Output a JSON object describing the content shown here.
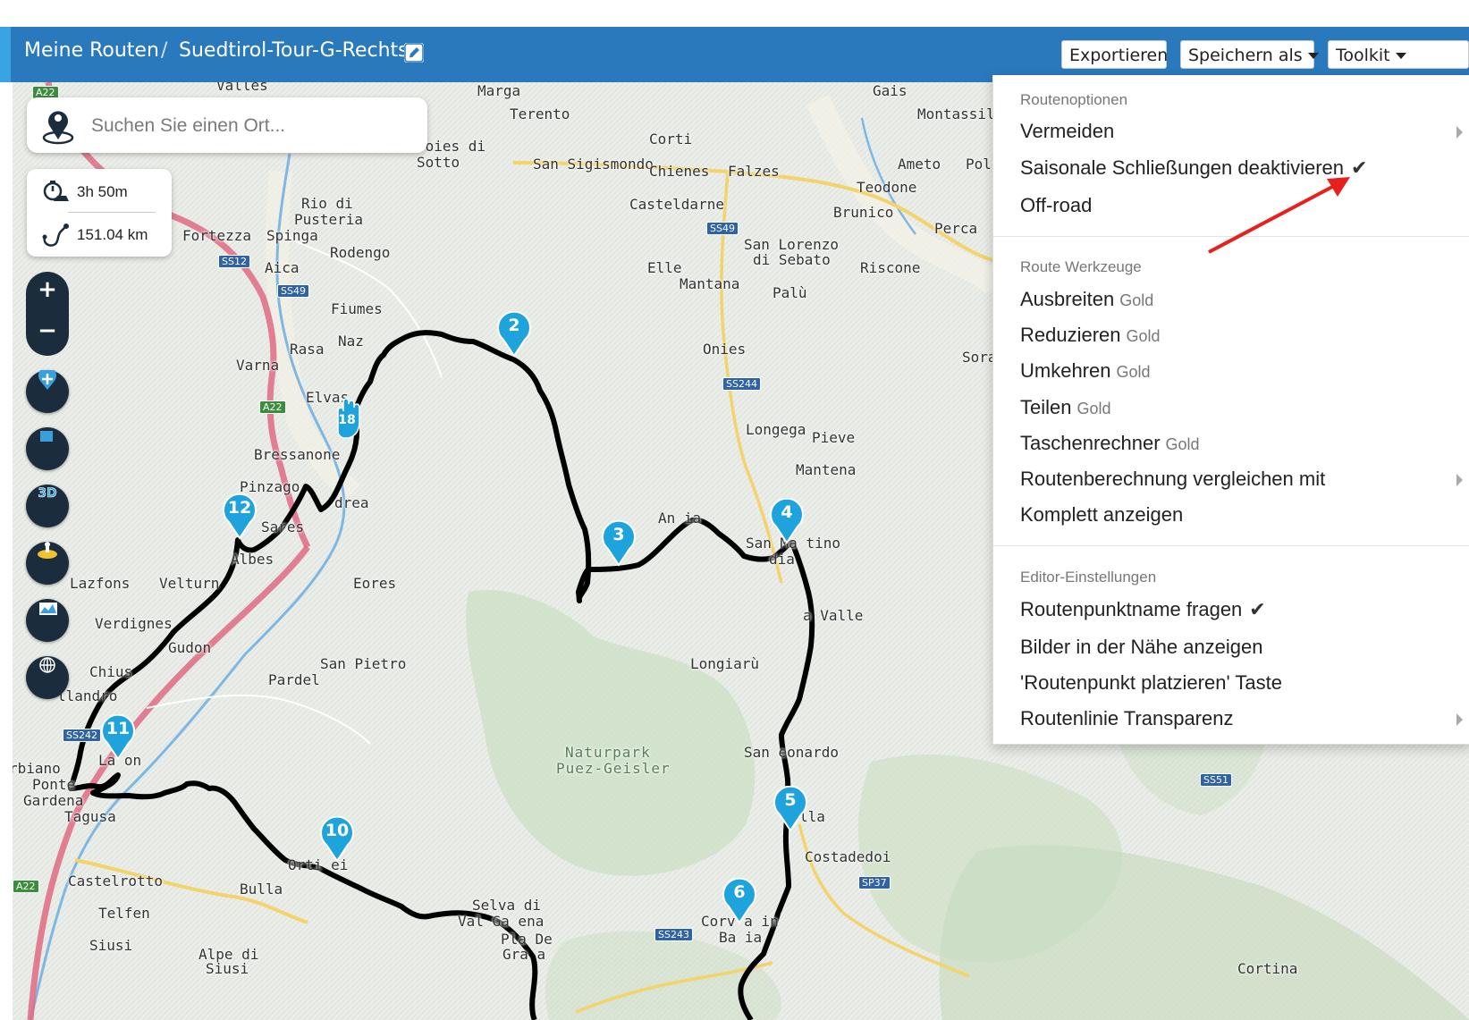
{
  "header": {
    "breadcrumb_home": "Meine Routen",
    "breadcrumb_sep": "/",
    "route_name": "Suedtirol-Tour-G-Rechts",
    "export_label": "Exportieren",
    "save_as_label": "Speichern als",
    "toolkit_label": "Toolkit",
    "bar_color": "#2a79bd"
  },
  "search": {
    "placeholder": "Suchen Sie einen Ort..."
  },
  "stats": {
    "duration": "3h 50m",
    "distance": "151.04 km"
  },
  "controls": {
    "zoom_in": "+",
    "zoom_out": "−",
    "three_d": "3D"
  },
  "menu": {
    "section_route_options": "Routenoptionen",
    "item_avoid": "Vermeiden",
    "item_seasonal": "Saisonale Schließungen deaktivieren",
    "item_offroad": "Off-road",
    "section_route_tools": "Route Werkzeuge",
    "item_expand": "Ausbreiten",
    "item_reduce": "Reduzieren",
    "item_reverse": "Umkehren",
    "item_split": "Teilen",
    "item_calculator": "Taschenrechner",
    "gold": "Gold",
    "item_compare": "Routenberechnung vergleichen mit",
    "item_show_all": "Komplett anzeigen",
    "section_editor": "Editor-Einstellungen",
    "item_ask_name": "Routenpunktname fragen",
    "item_nearby_images": "Bilder in der Nähe anzeigen",
    "item_place_button": "'Routenpunkt platzieren' Taste",
    "item_transparency": "Routenlinie Transparenz",
    "checkmark": "✔"
  },
  "waypoints": [
    "2",
    "3",
    "4",
    "5",
    "6",
    "10",
    "11",
    "12",
    "18"
  ],
  "map_labels": {
    "valles": "Valles",
    "marga": "Marga",
    "terento": "Terento",
    "gais": "Gais",
    "montassilone": "Montassilo",
    "joies": "Joies di",
    "sotto": "Sotto",
    "san_sigismondo": "San Sigismondo",
    "corti": "Corti",
    "chienes": "Chienes",
    "falzes": "Falzes",
    "ameto": "Ameto",
    "poli": "Poli",
    "teodone": "Teodone",
    "brunico": "Brunico",
    "perca": "Perca",
    "castel_darne": "Casteldarne",
    "rio_di": "Rio di",
    "pusteria": "Pusteria",
    "fortezza": "Fortezza",
    "spinga": "Spinga",
    "rodengo": "Rodengo",
    "aica": "Aica",
    "san_lorenzo": "San Lorenzo",
    "di_sebato": "di Sebato",
    "riscone": "Riscone",
    "elle": "Elle",
    "mantana": "Mantana",
    "palu": "Palù",
    "fiumes": "Fiumes",
    "naz": "Naz",
    "rasa": "Rasa",
    "varna": "Varna",
    "onies": "Onies",
    "sora": "Sora",
    "elvas": "Elvas",
    "bressanone": "Bressanone",
    "longega": "Longega",
    "pieve": "Pieve",
    "mantena": "Mantena",
    "pinzago": "Pinzago",
    "andrea": "drea",
    "sares": "Sares",
    "albes": "Albes",
    "lazfons": "Lazfons",
    "velturno": "Velturn",
    "eores": "Eores",
    "antermoia": "An       ia",
    "san_martino": "San Ma  tino",
    "badia": "   dia",
    "la_valle": "a Valle",
    "verdignes": "Verdignes",
    "gudon": "Gudon",
    "chiusa": "Chius",
    "san_pietro": "San Pietro",
    "pardel": "Pardel",
    "longiaru": "Longiarù",
    "villandro": "llandro",
    "san_leonardo": "San  eonardo",
    "naturpark": "Naturpark",
    "puez_geisler": "Puez-Geisler",
    "barbiano": "rbiano",
    "ponte": "Ponte",
    "gardena": "Gardena",
    "tagusa": "Tagusa",
    "laion": "La  on",
    "costadedoi": "Costadedoi",
    "castelrotto": "Castelrotto",
    "bulla": "Bulla",
    "telfen": "Telfen",
    "siusi": "Siusi",
    "alpe_di": "Alpe di",
    "siusi2": "Siusi",
    "ortisei": "Orti ei",
    "selva": "Selva di",
    "val_gardena": "Val Ga  ena",
    "plan_de": "Pla  De",
    "gralba": "Gra  a",
    "corvara": "Corv  a in",
    "badia2": "Ba  ia",
    "cortina": "Cortina",
    "la_villa": "  lla"
  },
  "road_signs": {
    "a22_top": "A22",
    "ss12": "SS12",
    "ss49": "SS49",
    "ss49b": "SS49",
    "a22_mid": "A22",
    "ss244": "SS244",
    "ss242": "SS242",
    "ss51": "SS51",
    "sp37": "SP37",
    "ss243": "SS243",
    "a22_bot": "A22"
  }
}
